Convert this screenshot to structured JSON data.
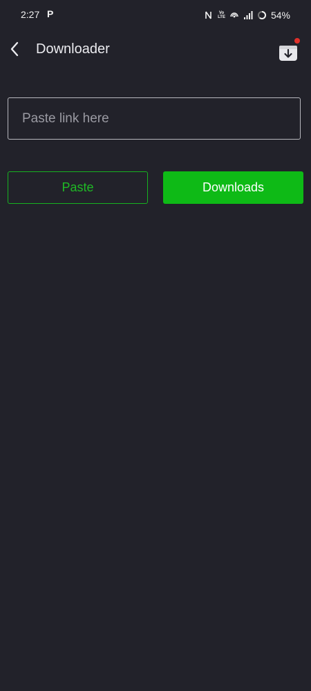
{
  "status_bar": {
    "time": "2:27",
    "app_glyph": "P",
    "network_label": "LTE",
    "volte_label": "Vo",
    "battery": "54%",
    "icons": [
      "nfc-icon",
      "volte-icon",
      "hotspot-icon",
      "signal-icon",
      "battery-ring-icon"
    ]
  },
  "app_bar": {
    "back_icon": "chevron-left-icon",
    "title": "Downloader",
    "downloads_icon": "download-box-icon",
    "notification_dot_color": "#e0302a"
  },
  "link_input": {
    "value": "",
    "placeholder": "Paste link here"
  },
  "actions": {
    "paste_label": "Paste",
    "downloads_label": "Downloads"
  },
  "colors": {
    "background": "#22222a",
    "accent_green": "#0eba16",
    "outline_green": "#17b320"
  }
}
